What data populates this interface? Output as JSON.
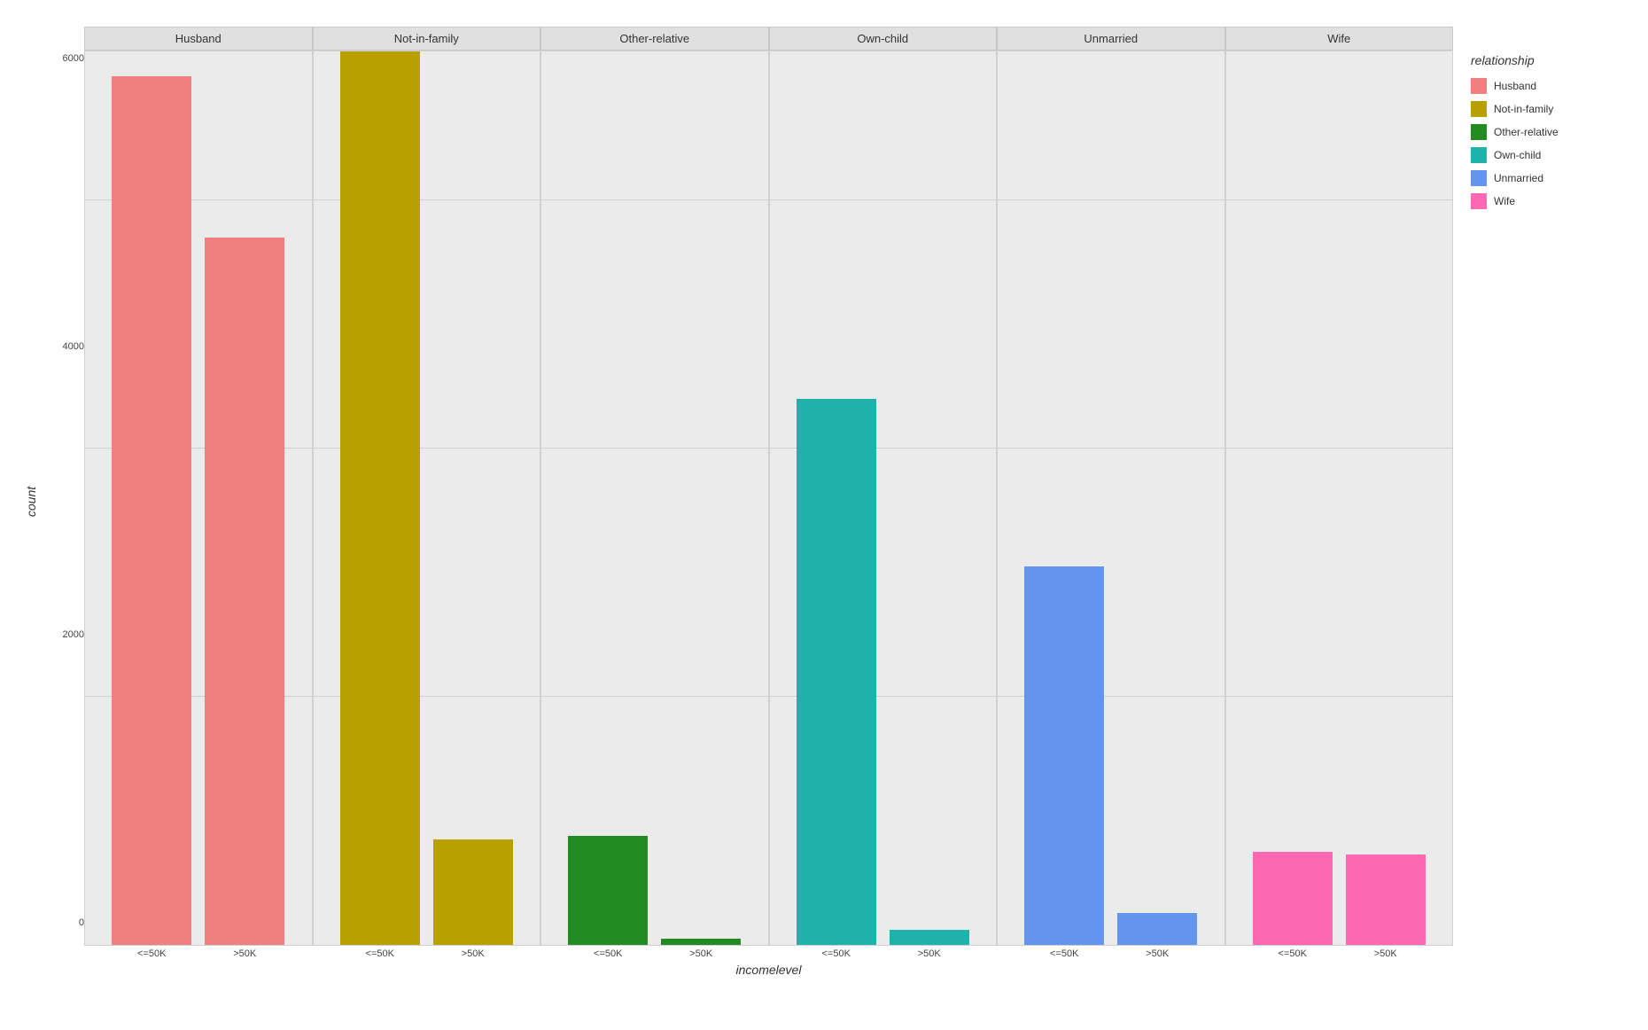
{
  "chart": {
    "title": "",
    "x_axis_title": "incomelevel",
    "y_axis_title": "count",
    "y_max": 7200,
    "y_ticks": [
      0,
      2000,
      4000,
      6000
    ],
    "facets": [
      {
        "title": "Husband",
        "color": "#F08080",
        "bars": [
          {
            "label": "<=50K",
            "value": 7000
          },
          {
            "label": ">50K",
            "value": 5700
          }
        ]
      },
      {
        "title": "Not-in-family",
        "color": "#B8A000",
        "bars": [
          {
            "label": "<=50K",
            "value": 7200
          },
          {
            "label": ">50K",
            "value": 850
          }
        ]
      },
      {
        "title": "Other-relative",
        "color": "#228B22",
        "bars": [
          {
            "label": "<=50K",
            "value": 880
          },
          {
            "label": ">50K",
            "value": 50
          }
        ]
      },
      {
        "title": "Own-child",
        "color": "#20B2AA",
        "bars": [
          {
            "label": "<=50K",
            "value": 4400
          },
          {
            "label": ">50K",
            "value": 120
          }
        ]
      },
      {
        "title": "Unmarried",
        "color": "#6495ED",
        "bars": [
          {
            "label": "<=50K",
            "value": 3050
          },
          {
            "label": ">50K",
            "value": 260
          }
        ]
      },
      {
        "title": "Wife",
        "color": "#FF69B4",
        "bars": [
          {
            "label": "<=50K",
            "value": 750
          },
          {
            "label": ">50K",
            "value": 730
          }
        ]
      }
    ],
    "legend": {
      "title": "relationship",
      "items": [
        {
          "label": "Husband",
          "color": "#F08080"
        },
        {
          "label": "Not-in-family",
          "color": "#B8A000"
        },
        {
          "label": "Other-relative",
          "color": "#228B22"
        },
        {
          "label": "Own-child",
          "color": "#20B2AA"
        },
        {
          "label": "Unmarried",
          "color": "#6495ED"
        },
        {
          "label": "Wife",
          "color": "#FF69B4"
        }
      ]
    }
  }
}
